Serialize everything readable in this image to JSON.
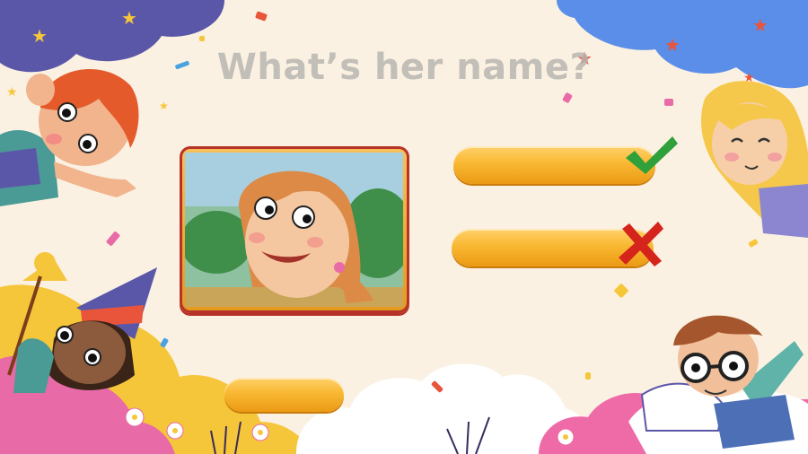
{
  "question": {
    "title": "What’s her name?"
  },
  "answers": [
    {
      "label": "",
      "status": "correct",
      "mark_icon": "checkmark-icon"
    },
    {
      "label": "",
      "status": "wrong",
      "mark_icon": "cross-icon"
    },
    {
      "label": ""
    }
  ],
  "colors": {
    "background": "#fbf1e2",
    "title": "#b9b6b1",
    "button": "#f9b832",
    "frame_border": "#b7332a",
    "check": "#2fa03a",
    "cross": "#d4241b",
    "cloud_purple": "#5b57a8",
    "cloud_blue": "#5b8ee8",
    "cloud_pink": "#e86aa6",
    "cloud_yellow": "#f6c63a"
  },
  "characters": [
    "boy-redhead",
    "girl-blonde",
    "girl-witch",
    "boy-glasses"
  ]
}
